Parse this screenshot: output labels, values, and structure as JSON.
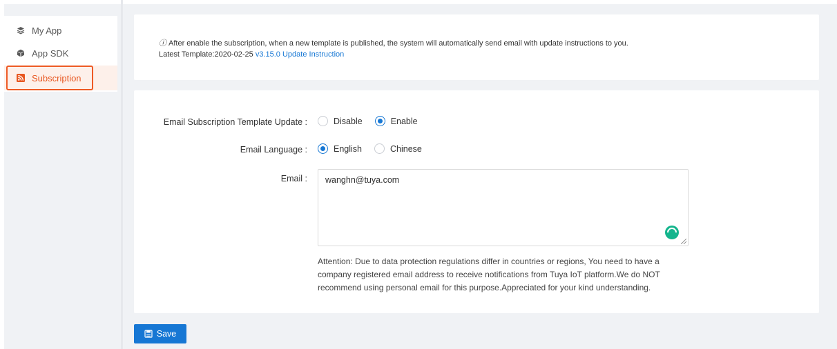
{
  "sidebar": {
    "items": [
      {
        "label": "My App",
        "icon": "layers-icon",
        "active": false
      },
      {
        "label": "App SDK",
        "icon": "cube-icon",
        "active": false
      },
      {
        "label": "Subscription",
        "icon": "rss-icon",
        "active": true
      }
    ]
  },
  "notice": {
    "line1": "After enable the subscription, when a new template is published, the system will automatically send email with update instructions to you.",
    "line2_prefix": "Latest Template:2020-02-25",
    "link": "v3.15.0 Update Instruction"
  },
  "form": {
    "template_update": {
      "label": "Email Subscription Template Update :",
      "options": [
        "Disable",
        "Enable"
      ],
      "selected": "Enable"
    },
    "language": {
      "label": "Email Language :",
      "options": [
        "English",
        "Chinese"
      ],
      "selected": "English"
    },
    "email": {
      "label": "Email :",
      "value": "wanghn@tuya.com"
    },
    "attention": "Attention: Due to data protection regulations differ in countries or regions, You need to have a company registered email address to receive notifications from Tuya IoT platform.We do NOT recommend using personal email for this purpose.Appreciated for your kind understanding."
  },
  "actions": {
    "save_label": "Save"
  },
  "colors": {
    "accent": "#1677d4",
    "active_nav": "#e8561f",
    "spinner": "#14b58d"
  }
}
